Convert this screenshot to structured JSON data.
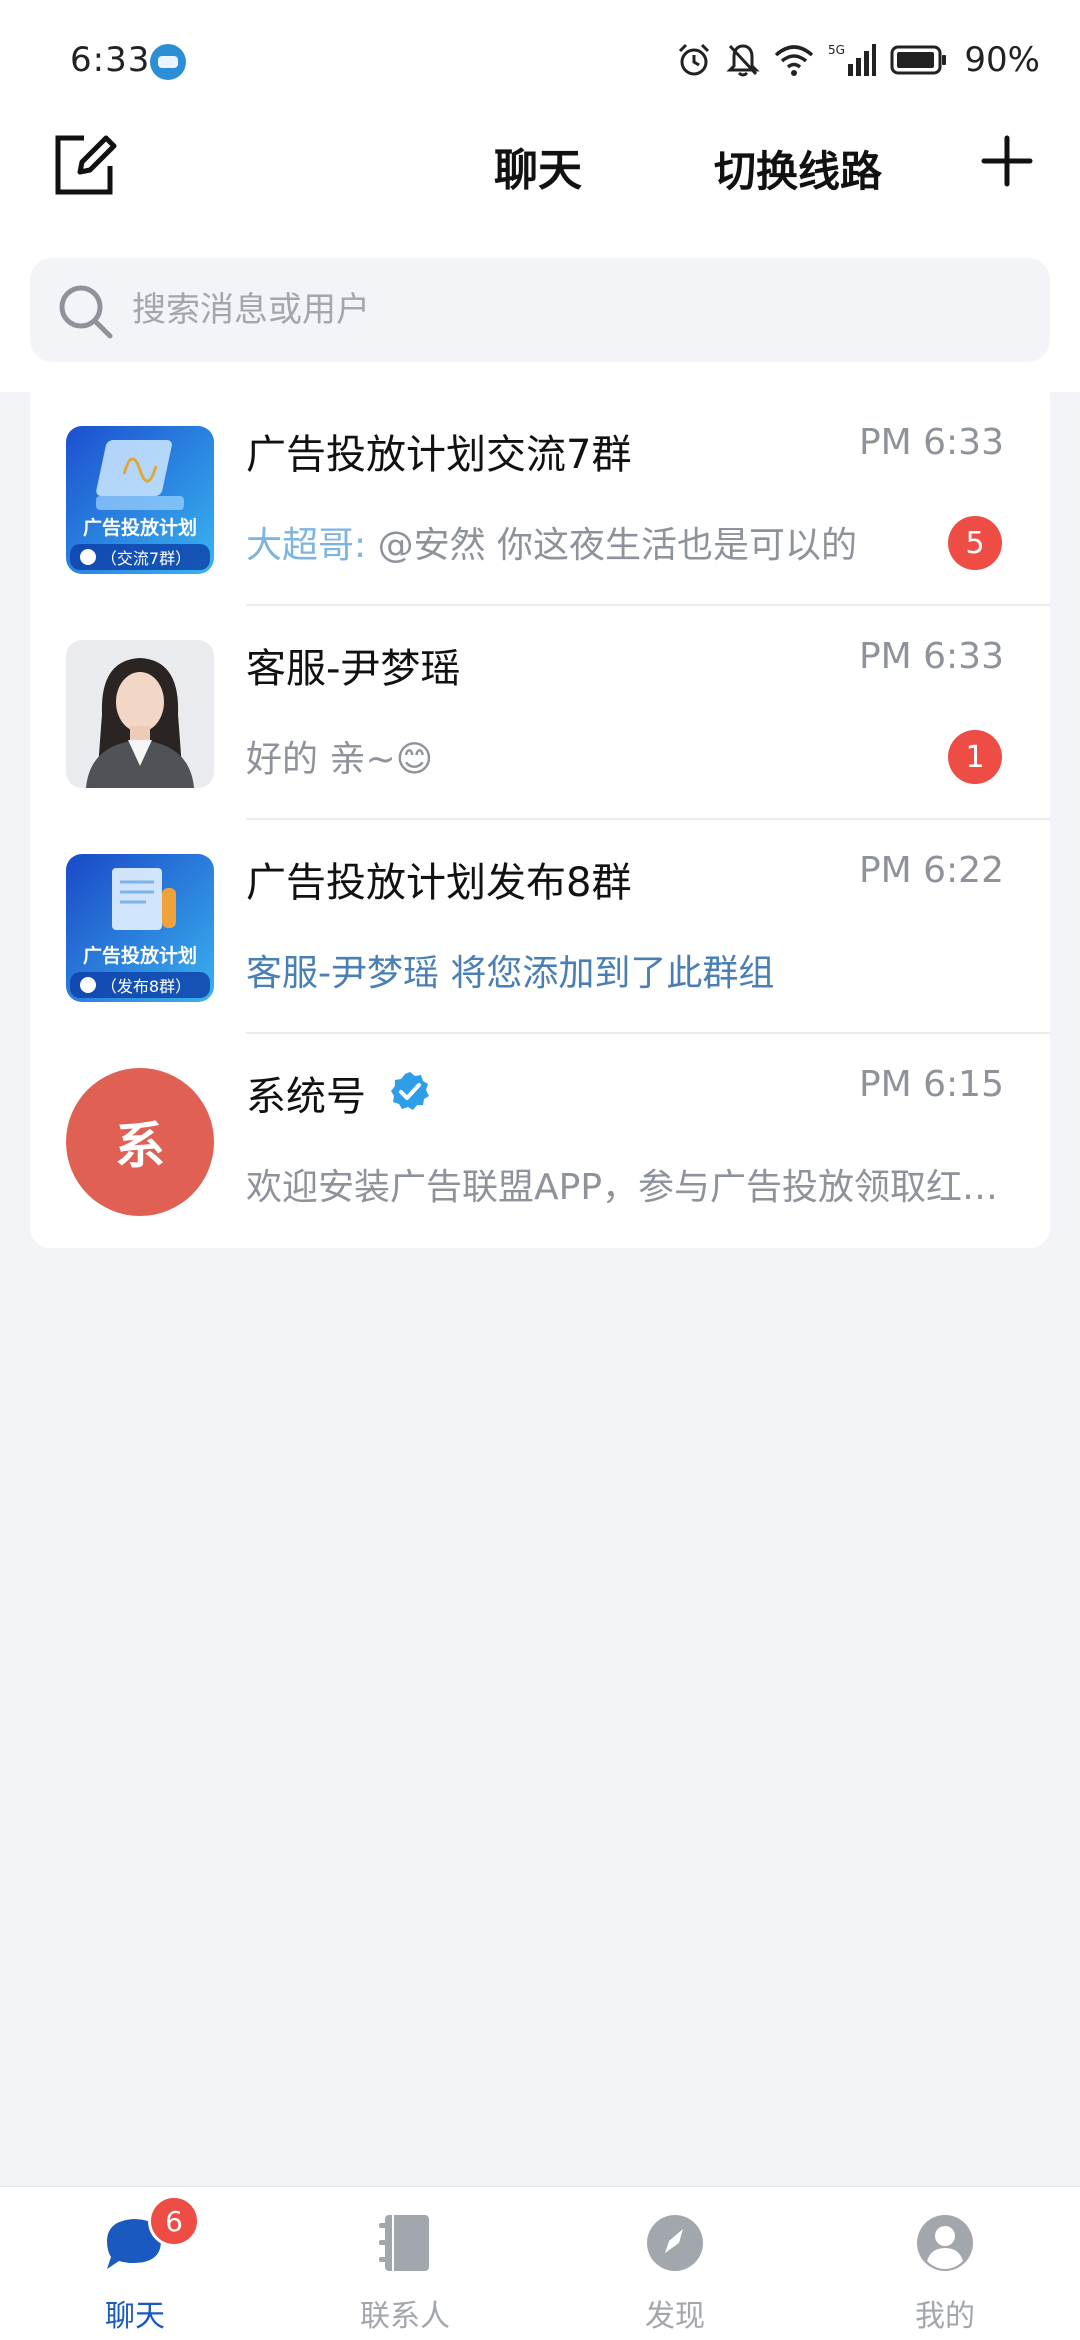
{
  "status_bar": {
    "time": "6:33",
    "battery": "90%"
  },
  "header": {
    "title": "聊天",
    "switch_line": "切换线路"
  },
  "search": {
    "placeholder": "搜索消息或用户"
  },
  "chats": [
    {
      "name": "广告投放计划交流7群",
      "time": "PM 6:33",
      "sender": "大超哥:",
      "message": " @安然 你这夜生活也是可以的",
      "unread": "5",
      "avatar_title": "广告投放计划",
      "avatar_sub": "（交流7群）"
    },
    {
      "name": "客服-尹梦瑶",
      "time": "PM 6:33",
      "message": "好的 亲~😊",
      "unread": "1"
    },
    {
      "name": "广告投放计划发布8群",
      "time": "PM 6:22",
      "message": "客服-尹梦瑶 将您添加到了此群组",
      "avatar_title": "广告投放计划",
      "avatar_sub": "（发布8群）"
    },
    {
      "name": "系统号",
      "time": "PM 6:15",
      "message": "欢迎安装广告联盟APP，参与广告投放领取红包奖励",
      "avatar_char": "系"
    }
  ],
  "bottom_nav": [
    {
      "label": "聊天",
      "badge": "6"
    },
    {
      "label": "联系人"
    },
    {
      "label": "发现"
    },
    {
      "label": "我的"
    }
  ],
  "colors": {
    "accent": "#1a5ac0",
    "badge": "#ee4d45",
    "system_avatar": "#e06054",
    "verified": "#2f9ee8"
  }
}
